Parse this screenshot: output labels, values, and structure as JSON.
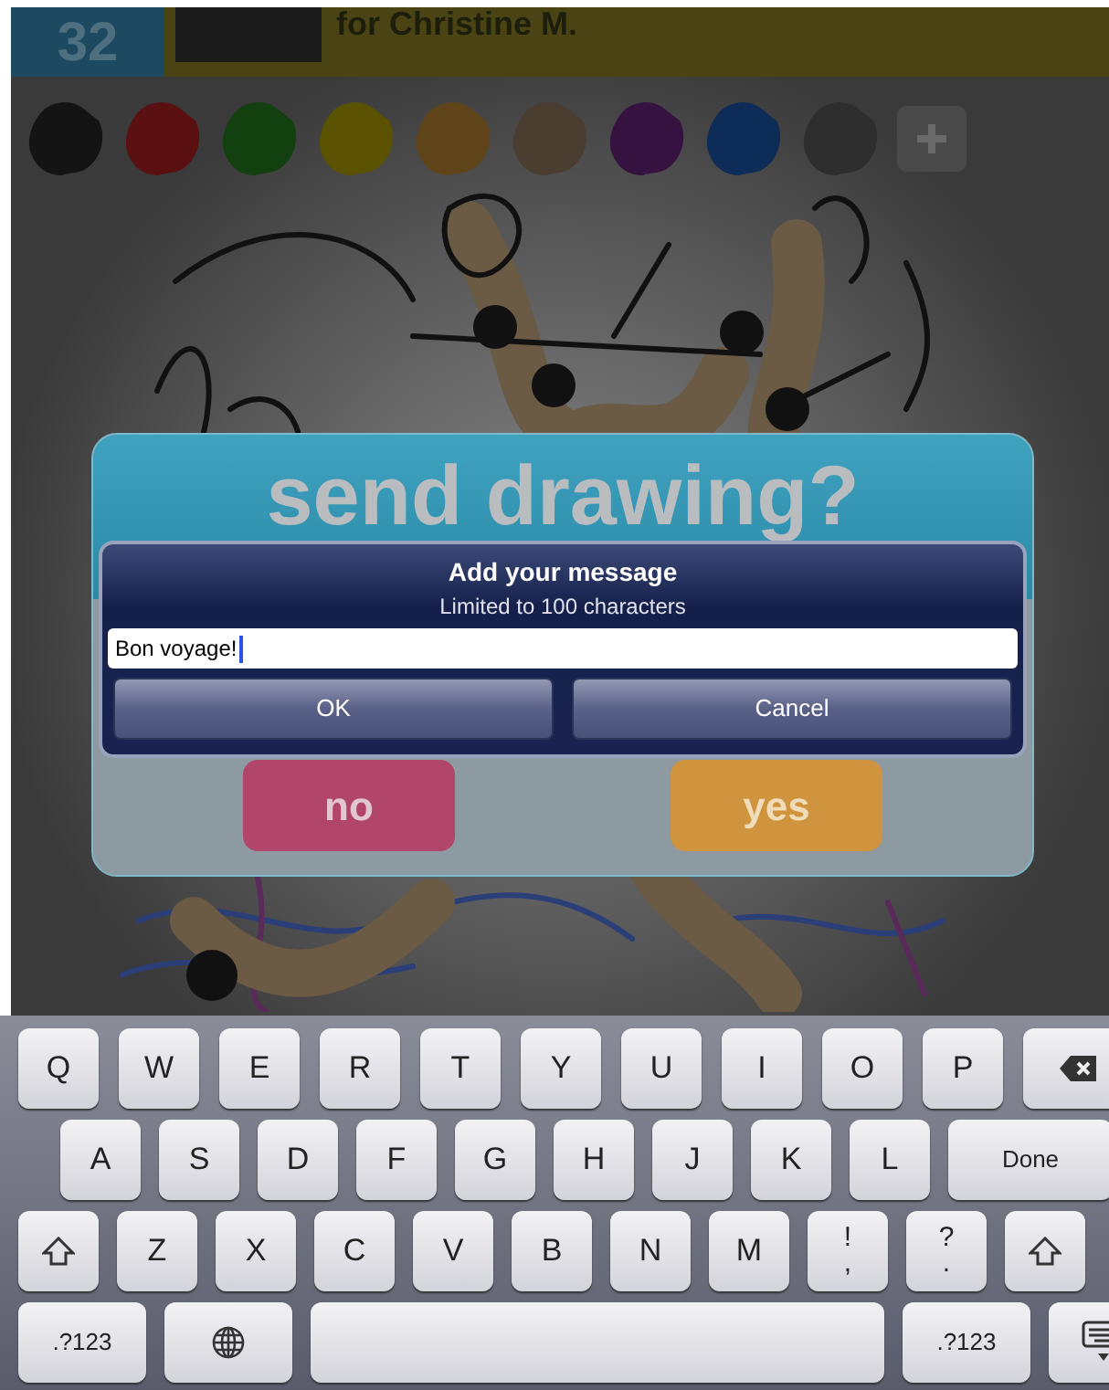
{
  "header": {
    "score": "32",
    "text": "for Christine M."
  },
  "palette": [
    {
      "color": "#141414"
    },
    {
      "color": "#5a0f10"
    },
    {
      "color": "#12400f"
    },
    {
      "color": "#5a5200"
    },
    {
      "color": "#5e4418"
    },
    {
      "color": "#4a3e30"
    },
    {
      "color": "#35123f"
    },
    {
      "color": "#0e2c58"
    },
    {
      "color": "#2e2e2e"
    }
  ],
  "confirm": {
    "title": "send drawing?",
    "no": "no",
    "yes": "yes"
  },
  "alert": {
    "title": "Add your message",
    "subtitle": "Limited to 100 characters",
    "value": "Bon voyage!",
    "buttons": [
      "OK",
      "Cancel"
    ]
  },
  "keyboard": {
    "rows": [
      {
        "keys": [
          {
            "kind": "letter",
            "label": "Q"
          },
          {
            "kind": "letter",
            "label": "W"
          },
          {
            "kind": "letter",
            "label": "E"
          },
          {
            "kind": "letter",
            "label": "R"
          },
          {
            "kind": "letter",
            "label": "T"
          },
          {
            "kind": "letter",
            "label": "Y"
          },
          {
            "kind": "letter",
            "label": "U"
          },
          {
            "kind": "letter",
            "label": "I"
          },
          {
            "kind": "letter",
            "label": "O"
          },
          {
            "kind": "letter",
            "label": "P"
          },
          {
            "kind": "backspace"
          }
        ]
      },
      {
        "keys": [
          {
            "kind": "letter",
            "label": "A"
          },
          {
            "kind": "letter",
            "label": "S"
          },
          {
            "kind": "letter",
            "label": "D"
          },
          {
            "kind": "letter",
            "label": "F"
          },
          {
            "kind": "letter",
            "label": "G"
          },
          {
            "kind": "letter",
            "label": "H"
          },
          {
            "kind": "letter",
            "label": "J"
          },
          {
            "kind": "letter",
            "label": "K"
          },
          {
            "kind": "letter",
            "label": "L"
          },
          {
            "kind": "done",
            "label": "Done"
          }
        ]
      },
      {
        "keys": [
          {
            "kind": "shift"
          },
          {
            "kind": "letter",
            "label": "Z"
          },
          {
            "kind": "letter",
            "label": "X"
          },
          {
            "kind": "letter",
            "label": "C"
          },
          {
            "kind": "letter",
            "label": "V"
          },
          {
            "kind": "letter",
            "label": "B"
          },
          {
            "kind": "letter",
            "label": "N"
          },
          {
            "kind": "letter",
            "label": "M"
          },
          {
            "kind": "dual",
            "label": "!",
            "sub": ","
          },
          {
            "kind": "dual",
            "label": "?",
            "sub": "."
          },
          {
            "kind": "shift"
          }
        ]
      },
      {
        "keys": [
          {
            "kind": "mode",
            "label": ".?123"
          },
          {
            "kind": "globe"
          },
          {
            "kind": "space"
          },
          {
            "kind": "mode",
            "label": ".?123"
          },
          {
            "kind": "hide"
          }
        ]
      }
    ]
  }
}
